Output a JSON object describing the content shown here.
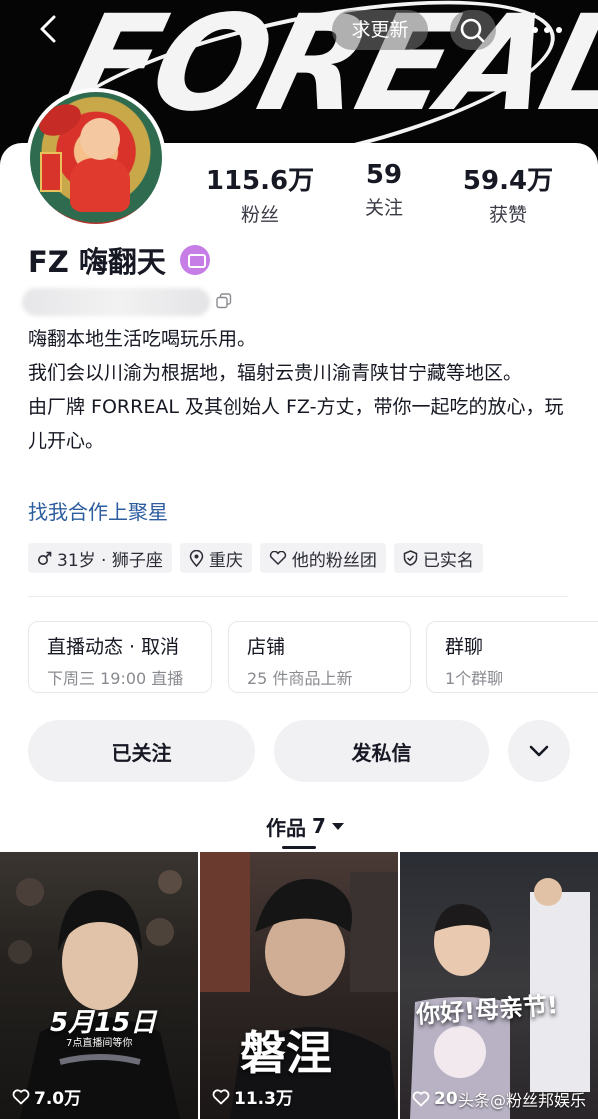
{
  "topbar": {
    "banner_text": "FOREAL",
    "pill_label": "求更新",
    "back_icon": "chevron-left-icon",
    "search_icon": "search-icon",
    "more_icon": "more-dots-icon"
  },
  "profile": {
    "name": "FZ 嗨翻天",
    "stats": [
      {
        "value": "115.6万",
        "label": "粉丝"
      },
      {
        "value": "59",
        "label": "关注"
      },
      {
        "value": "59.4万",
        "label": "获赞"
      }
    ],
    "bio": [
      "嗨翻本地生活吃喝玩乐用。",
      "我们会以川渝为根据地，辐射云贵川渝青陕甘宁藏等地区。",
      "由厂牌 FORREAL 及其创始人 FZ-方丈，带你一起吃的放心，玩儿开心。"
    ],
    "collab_link": "找我合作上聚星",
    "tags": [
      {
        "icon": "male-icon",
        "text": "31岁 · 狮子座"
      },
      {
        "icon": "location-icon",
        "text": "重庆"
      },
      {
        "icon": "fan-club-icon",
        "text": "他的粉丝团"
      },
      {
        "icon": "verified-shield-icon",
        "text": "已实名"
      }
    ]
  },
  "feature_cards": [
    {
      "title": "直播动态 · 取消",
      "sub": "下周三 19:00 直播"
    },
    {
      "title": "店铺",
      "sub": "25 件商品上新"
    },
    {
      "title": "群聊",
      "sub": "1个群聊"
    }
  ],
  "actions": {
    "follow_label": "已关注",
    "message_label": "发私信",
    "more_icon": "chevron-down-icon"
  },
  "works": {
    "label": "作品",
    "count": "7"
  },
  "videos": [
    {
      "likes": "7.0万",
      "caption": "5月15日",
      "subcaption": "7点直播间等你"
    },
    {
      "likes": "11.3万",
      "caption": "磐涅"
    },
    {
      "likes": "20",
      "caption": "你好!母亲节!",
      "watermark": "头条@粉丝邦娱乐"
    }
  ],
  "colors": {
    "link": "#2d5d9f",
    "verify_badge": "#c67de6",
    "button_bg": "#f1f1f3"
  }
}
